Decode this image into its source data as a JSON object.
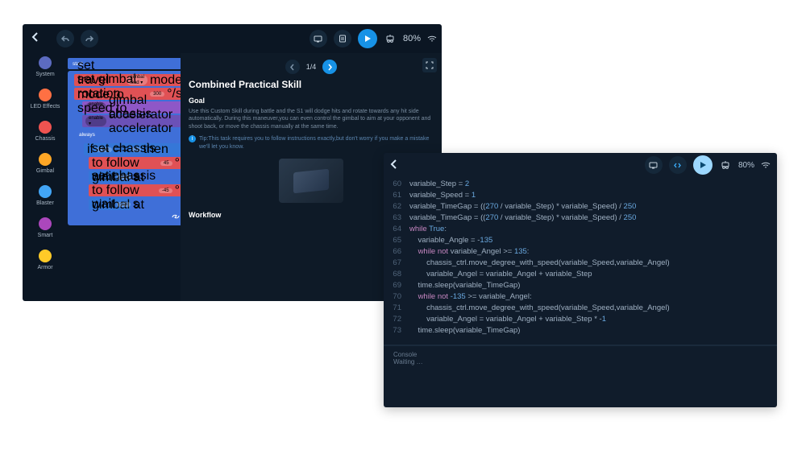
{
  "window1": {
    "battery": "80%",
    "sidebar": [
      {
        "label": "System",
        "color": "#5c6bc0"
      },
      {
        "label": "LED Effects",
        "color": "#ff7043"
      },
      {
        "label": "Chassis",
        "color": "#ef5350"
      },
      {
        "label": "Gimbal",
        "color": "#ffa726"
      },
      {
        "label": "Blaster",
        "color": "#42a5f5"
      },
      {
        "label": "Smart",
        "color": "#ab47bc"
      },
      {
        "label": "Armor",
        "color": "#ffca28"
      }
    ],
    "blocks": {
      "start": "start",
      "travel_mode": "set travel mode to",
      "travel_mode_val": "gimbal lead ▾",
      "travel_mode_suffix": "mode",
      "rot_speed": "set gimbal rotation speed to",
      "rot_speed_val": "300",
      "rot_speed_unit": "°/s",
      "enable1": "enable ▾",
      "enable1_arg": "gimbal accelerator",
      "enable2": "enable ▾",
      "enable2_arg": "chassis accelerator",
      "always": "always",
      "if": "if",
      "flag": "Flag",
      "eq": "==",
      "one": "1",
      "then": "then",
      "chassis_follow": "set chassis to follow gimbal at",
      "angle_pos": "45",
      "angle_neg": "-45",
      "deg": "°",
      "wait": "wait",
      "wait_val": "0.3",
      "wait_unit": "s"
    },
    "tutorial": {
      "pager": "1/4",
      "title": "Combined Practical Skill",
      "h_goal": "Goal",
      "p_goal": "Use this Custom Skill during battle and the S1 will dodge hits and rotate towards any hit side automatically. During this maneuver,you can even control the gimbal to aim at your opponent and shoot back, or move the chassis manually at the same time.",
      "tip": "Tip:This task requires you to follow instructions exactly,but don't worry if you make a mistake we'll let you know.",
      "h_workflow": "Workflow"
    }
  },
  "window2": {
    "battery": "80%",
    "code": [
      {
        "n": 60,
        "i": 0,
        "t": "variable_Step = 2"
      },
      {
        "n": 61,
        "i": 0,
        "t": "variable_Speed = 1"
      },
      {
        "n": 62,
        "i": 0,
        "t": "variable_TimeGap = ((270 / variable_Step) * variable_Speed) / 250"
      },
      {
        "n": 63,
        "i": 0,
        "t": "variable_TimeGap = ((270 / variable_Step) * variable_Speed) / 250"
      },
      {
        "n": 64,
        "i": 0,
        "kw": "while ",
        "kw2": "True",
        "suffix": ":"
      },
      {
        "n": 65,
        "i": 1,
        "t": "variable_Angle = -135"
      },
      {
        "n": 66,
        "i": 1,
        "kw": "while not ",
        "mid": "variable_Angel >= ",
        "num": "135",
        "suffix": ":"
      },
      {
        "n": 67,
        "i": 2,
        "t": "chassis_ctrl.move_degree_with_speed(variable_Speed,variable_Angel)"
      },
      {
        "n": 68,
        "i": 2,
        "t": "variable_Angel = variable_Angel + variable_Step"
      },
      {
        "n": 69,
        "i": 1,
        "t": "time.sleep(variable_TimeGap)"
      },
      {
        "n": 70,
        "i": 1,
        "kw": "while not ",
        "num": "-135",
        "mid2": " >= variable_Angel",
        "suffix": ":"
      },
      {
        "n": 71,
        "i": 2,
        "t": "chassis_ctrl.move_degree_with_speed(variable_Speed,variable_Angel)"
      },
      {
        "n": 72,
        "i": 2,
        "t": "variable_Angel = variable_Angel + variable_Step * -1"
      },
      {
        "n": 73,
        "i": 1,
        "t": "time.sleep(variable_TimeGap)"
      }
    ],
    "console": {
      "label": "Console",
      "status": "Waiting …"
    }
  }
}
